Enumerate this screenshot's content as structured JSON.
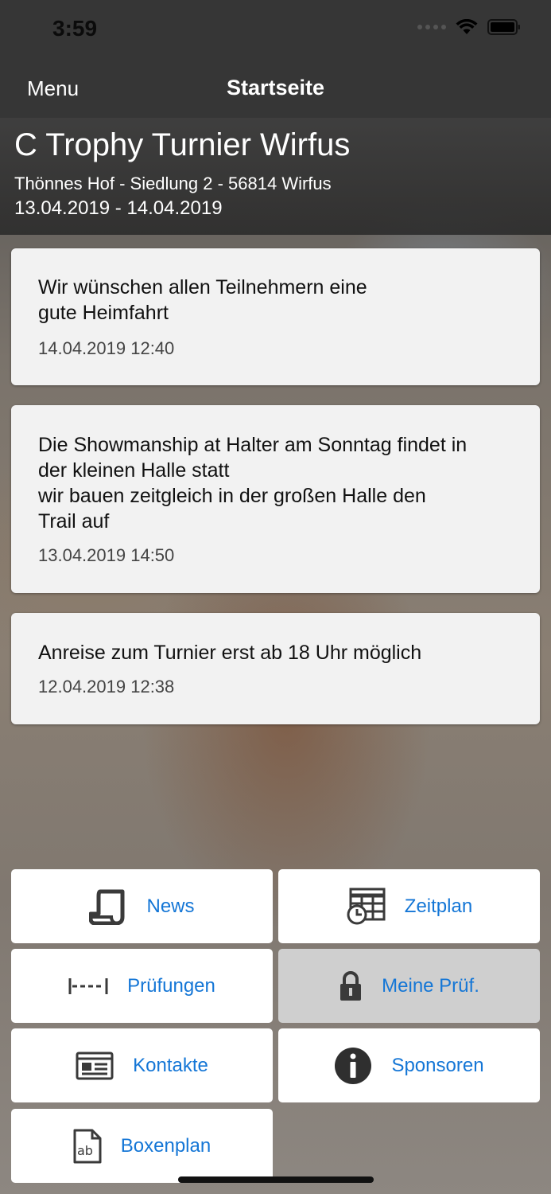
{
  "status_bar": {
    "time": "3:59"
  },
  "nav": {
    "menu_label": "Menu",
    "title": "Startseite"
  },
  "event": {
    "title": "C Trophy Turnier Wirfus",
    "address": "Thönnes Hof - Siedlung 2 - 56814 Wirfus",
    "dates": "13.04.2019 - 14.04.2019"
  },
  "news": [
    {
      "message": "Wir wünschen allen Teilnehmern eine\ngute Heimfahrt",
      "timestamp": "14.04.2019 12:40"
    },
    {
      "message": "Die Showmanship at Halter am Sonntag findet in\nder kleinen Halle statt\nwir bauen zeitgleich in der großen Halle den\nTrail auf",
      "timestamp": "13.04.2019 14:50"
    },
    {
      "message": "Anreise zum Turnier erst ab 18 Uhr möglich",
      "timestamp": "12.04.2019 12:38"
    }
  ],
  "tiles": [
    {
      "label": "News",
      "icon": "news-scroll-icon",
      "enabled": true
    },
    {
      "label": "Zeitplan",
      "icon": "schedule-icon",
      "enabled": true
    },
    {
      "label": "Prüfungen",
      "icon": "classes-icon",
      "enabled": true
    },
    {
      "label": "Meine Prüf.",
      "icon": "lock-icon",
      "enabled": false
    },
    {
      "label": "Kontakte",
      "icon": "contact-card-icon",
      "enabled": true
    },
    {
      "label": "Sponsoren",
      "icon": "info-icon",
      "enabled": true
    },
    {
      "label": "Boxenplan",
      "icon": "document-ab-icon",
      "enabled": true
    }
  ],
  "colors": {
    "accent": "#1476d6",
    "bar": "#363636",
    "card": "#f2f2f2",
    "disabled_tile": "#cfcfcf"
  }
}
